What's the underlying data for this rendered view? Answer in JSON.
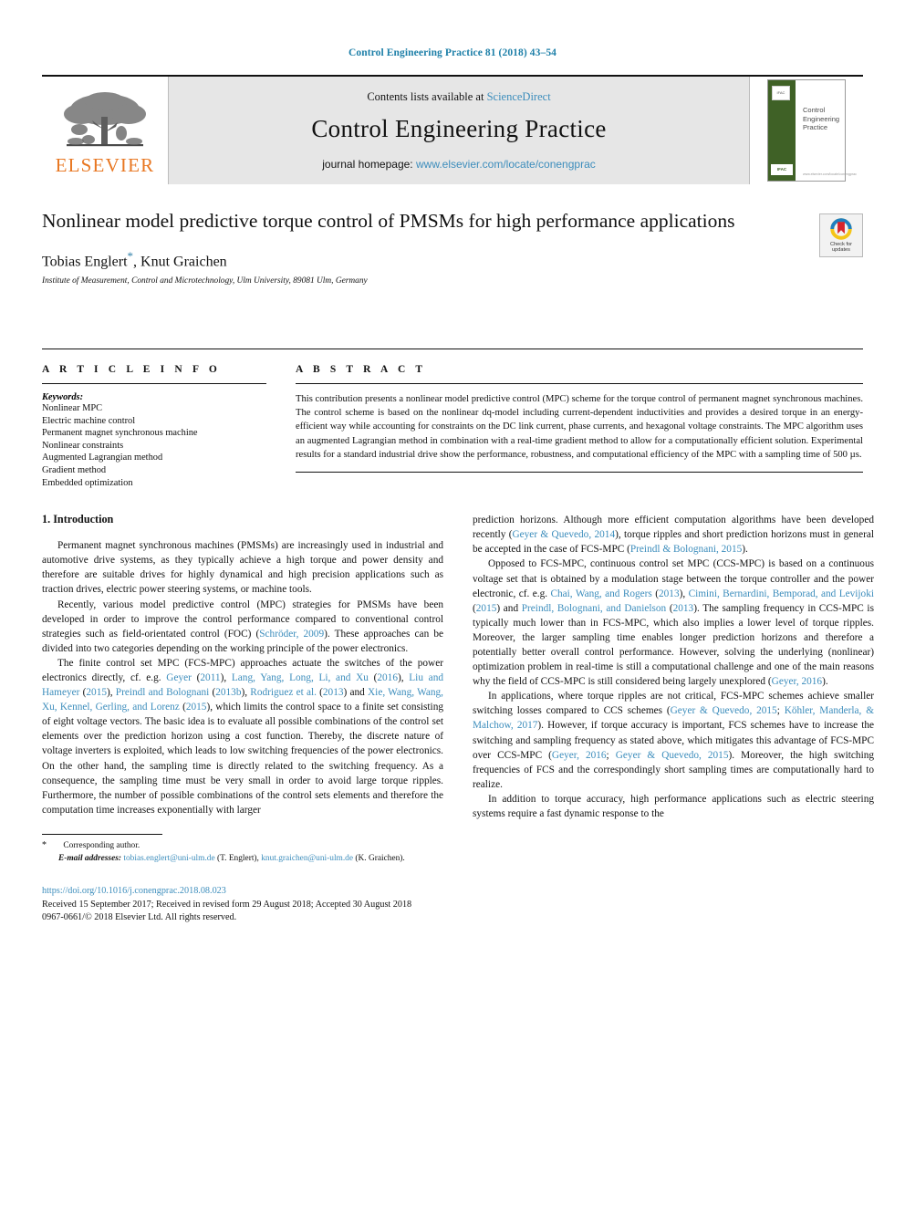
{
  "running_head": "Control Engineering Practice 81 (2018) 43–54",
  "masthead": {
    "contents_prefix": "Contents lists available at ",
    "contents_link": "ScienceDirect",
    "journal_title": "Control Engineering Practice",
    "homepage_prefix": "journal homepage: ",
    "homepage_link": "www.elsevier.com/locate/conengprac",
    "publisher_wordmark": "ELSEVIER",
    "cover": {
      "title_line1": "Control",
      "title_line2": "Engineering",
      "title_line3": "Practice",
      "badge_top": "IFAC",
      "badge_bottom": "IFAC",
      "url": "www.elsevier.com/locate/conengprac"
    },
    "colors": {
      "link": "#3c8dbc",
      "panel_bg": "#e6e6e6",
      "elsevier_orange": "#e87722",
      "cover_green": "#3f6126"
    }
  },
  "article": {
    "title": "Nonlinear model predictive torque control of PMSMs for high performance applications",
    "authors": "Tobias Englert",
    "authors_rest": ", Knut Graichen",
    "corresponding_marker": "*",
    "affiliation": "Institute of Measurement, Control and Microtechnology, Ulm University, 89081 Ulm, Germany",
    "crossmark": {
      "line1": "Check for",
      "line2": "updates"
    }
  },
  "article_info": {
    "heading": "A R T I C L E   I N F O",
    "keywords_label": "Keywords:",
    "keywords": [
      "Nonlinear MPC",
      "Electric machine control",
      "Permanent magnet synchronous machine",
      "Nonlinear constraints",
      "Augmented Lagrangian method",
      "Gradient method",
      "Embedded optimization"
    ]
  },
  "abstract": {
    "heading": "A B S T R A C T",
    "text": "This contribution presents a nonlinear model predictive control (MPC) scheme for the torque control of permanent magnet synchronous machines. The control scheme is based on the nonlinear dq-model including current-dependent inductivities and provides a desired torque in an energy-efficient way while accounting for constraints on the DC link current, phase currents, and hexagonal voltage constraints. The MPC algorithm uses an augmented Lagrangian method in combination with a real-time gradient method to allow for a computationally efficient solution. Experimental results for a standard industrial drive show the performance, robustness, and computational efficiency of the MPC with a sampling time of 500 µs."
  },
  "sections": {
    "intro_heading": "1.  Introduction"
  },
  "left_column": {
    "paragraphs": [
      {
        "parts": [
          {
            "t": "Permanent magnet synchronous machines (PMSMs) are increasingly used in industrial and automotive drive systems, as they typically achieve a high torque and power density and therefore are suitable drives for highly dynamical and high precision applications such as traction drives, electric power steering systems, or machine tools.",
            "link": false
          }
        ]
      },
      {
        "parts": [
          {
            "t": "Recently, various model predictive control (MPC) strategies for PMSMs have been developed in order to improve the control performance compared to conventional control strategies such as field-orientated control (FOC) (",
            "link": false
          },
          {
            "t": "Schröder, 2009",
            "link": true
          },
          {
            "t": "). These approaches can be divided into two categories depending on the working principle of the power electronics.",
            "link": false
          }
        ]
      },
      {
        "parts": [
          {
            "t": "The finite control set MPC (FCS-MPC) approaches actuate the switches of the power electronics directly, cf. e.g. ",
            "link": false
          },
          {
            "t": "Geyer",
            "link": true
          },
          {
            "t": " (",
            "link": false
          },
          {
            "t": "2011",
            "link": true
          },
          {
            "t": "), ",
            "link": false
          },
          {
            "t": "Lang, Yang, Long, Li, and Xu",
            "link": true
          },
          {
            "t": " (",
            "link": false
          },
          {
            "t": "2016",
            "link": true
          },
          {
            "t": "), ",
            "link": false
          },
          {
            "t": "Liu and Hameyer",
            "link": true
          },
          {
            "t": " (",
            "link": false
          },
          {
            "t": "2015",
            "link": true
          },
          {
            "t": "), ",
            "link": false
          },
          {
            "t": "Preindl and Bolognani",
            "link": true
          },
          {
            "t": " (",
            "link": false
          },
          {
            "t": "2013b",
            "link": true
          },
          {
            "t": "), ",
            "link": false
          },
          {
            "t": "Rodriguez et al.",
            "link": true
          },
          {
            "t": " (",
            "link": false
          },
          {
            "t": "2013",
            "link": true
          },
          {
            "t": ") and ",
            "link": false
          },
          {
            "t": "Xie, Wang, Wang, Xu, Kennel, Gerling, and Lorenz",
            "link": true
          },
          {
            "t": " (",
            "link": false
          },
          {
            "t": "2015",
            "link": true
          },
          {
            "t": "), which limits the control space to a finite set consisting of eight voltage vectors. The basic idea is to evaluate all possible combinations of the control set elements over the prediction horizon using a cost function. Thereby, the discrete nature of voltage inverters is exploited, which leads to low switching frequencies of the power electronics. On the other hand, the sampling time is directly related to the switching frequency. As a consequence, the sampling time must be very small in order to avoid large torque ripples. Furthermore, the number of possible combinations of the control sets elements and therefore the computation time increases exponentially with larger",
            "link": false
          }
        ]
      }
    ]
  },
  "right_column": {
    "paragraphs": [
      {
        "continuation": true,
        "parts": [
          {
            "t": "prediction horizons. Although more efficient computation algorithms have been developed recently (",
            "link": false
          },
          {
            "t": "Geyer & Quevedo, 2014",
            "link": true
          },
          {
            "t": "), torque ripples and short prediction horizons must in general be accepted in the case of FCS-MPC (",
            "link": false
          },
          {
            "t": "Preindl & Bolognani, 2015",
            "link": true
          },
          {
            "t": ").",
            "link": false
          }
        ]
      },
      {
        "parts": [
          {
            "t": "Opposed to FCS-MPC, continuous control set MPC (CCS-MPC) is based on a continuous voltage set that is obtained by a modulation stage between the torque controller and the power electronic, cf. e.g. ",
            "link": false
          },
          {
            "t": "Chai, Wang, and Rogers",
            "link": true
          },
          {
            "t": " (",
            "link": false
          },
          {
            "t": "2013",
            "link": true
          },
          {
            "t": "), ",
            "link": false
          },
          {
            "t": "Cimini, Bernardini, Bemporad, and Levijoki",
            "link": true
          },
          {
            "t": " (",
            "link": false
          },
          {
            "t": "2015",
            "link": true
          },
          {
            "t": ") and ",
            "link": false
          },
          {
            "t": "Preindl, Bolognani, and Danielson",
            "link": true
          },
          {
            "t": " (",
            "link": false
          },
          {
            "t": "2013",
            "link": true
          },
          {
            "t": "). The sampling frequency in CCS-MPC is typically much lower than in FCS-MPC, which also implies a lower level of torque ripples. Moreover, the larger sampling time enables longer prediction horizons and therefore a potentially better overall control performance. However, solving the underlying (nonlinear) optimization problem in real-time is still a computational challenge and one of the main reasons why the field of CCS-MPC is still considered being largely unexplored (",
            "link": false
          },
          {
            "t": "Geyer, 2016",
            "link": true
          },
          {
            "t": ").",
            "link": false
          }
        ]
      },
      {
        "parts": [
          {
            "t": "In applications, where torque ripples are not critical, FCS-MPC schemes achieve smaller switching losses compared to CCS schemes (",
            "link": false
          },
          {
            "t": "Geyer & Quevedo, 2015",
            "link": true
          },
          {
            "t": "; ",
            "link": false
          },
          {
            "t": "Köhler, Manderla, & Malchow, 2017",
            "link": true
          },
          {
            "t": "). However, if torque accuracy is important, FCS schemes have to increase the switching and sampling frequency as stated above, which mitigates this advantage of FCS-MPC over CCS-MPC (",
            "link": false
          },
          {
            "t": "Geyer, 2016",
            "link": true
          },
          {
            "t": "; ",
            "link": false
          },
          {
            "t": "Geyer & Quevedo, 2015",
            "link": true
          },
          {
            "t": "). Moreover, the high switching frequencies of FCS and the correspondingly short sampling times are computationally hard to realize.",
            "link": false
          }
        ]
      },
      {
        "parts": [
          {
            "t": "In addition to torque accuracy, high performance applications such as electric steering systems require a fast dynamic response to the",
            "link": false
          }
        ]
      }
    ]
  },
  "footnotes": {
    "corresponding": "Corresponding author.",
    "email_label": "E-mail addresses:",
    "email1": "tobias.englert@uni-ulm.de",
    "email1_owner": " (T. Englert), ",
    "email2": "knut.graichen@uni-ulm.de",
    "email2_owner": " (K. Graichen)."
  },
  "footer": {
    "doi": "https://doi.org/10.1016/j.conengprac.2018.08.023",
    "dates": "Received 15 September 2017; Received in revised form 29 August 2018; Accepted 30 August 2018",
    "copyright": "0967-0661/© 2018 Elsevier Ltd. All rights reserved."
  }
}
